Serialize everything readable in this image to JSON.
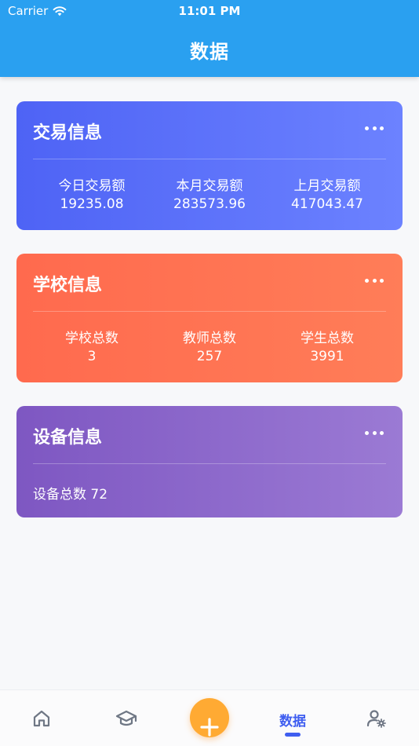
{
  "status_bar": {
    "carrier": "Carrier",
    "time": "11:01 PM"
  },
  "header": {
    "title": "数据"
  },
  "colors": {
    "header": "#2aa0f0",
    "card_transactions": "#5a70f8",
    "card_school": "#ff7253",
    "card_devices": "#8c68cb",
    "active_tab": "#3f5ef0",
    "add_button": "#ffaa33"
  },
  "cards": {
    "transactions": {
      "title": "交易信息",
      "more_icon": "ellipsis-icon",
      "stats": [
        {
          "label": "今日交易额",
          "value": "19235.08"
        },
        {
          "label": "本月交易额",
          "value": "283573.96"
        },
        {
          "label": "上月交易额",
          "value": "417043.47"
        }
      ]
    },
    "school": {
      "title": "学校信息",
      "more_icon": "ellipsis-icon",
      "stats": [
        {
          "label": "学校总数",
          "value": "3"
        },
        {
          "label": "教师总数",
          "value": "257"
        },
        {
          "label": "学生总数",
          "value": "3991"
        }
      ]
    },
    "devices": {
      "title": "设备信息",
      "more_icon": "ellipsis-icon",
      "summary": "设备总数 72"
    }
  },
  "tabbar": {
    "items": [
      {
        "name": "home",
        "icon": "home-icon"
      },
      {
        "name": "school",
        "icon": "graduation-cap-icon"
      },
      {
        "name": "add",
        "icon": "plus-icon"
      },
      {
        "name": "data",
        "label": "数据",
        "active": true
      },
      {
        "name": "settings",
        "icon": "user-settings-icon"
      }
    ]
  }
}
